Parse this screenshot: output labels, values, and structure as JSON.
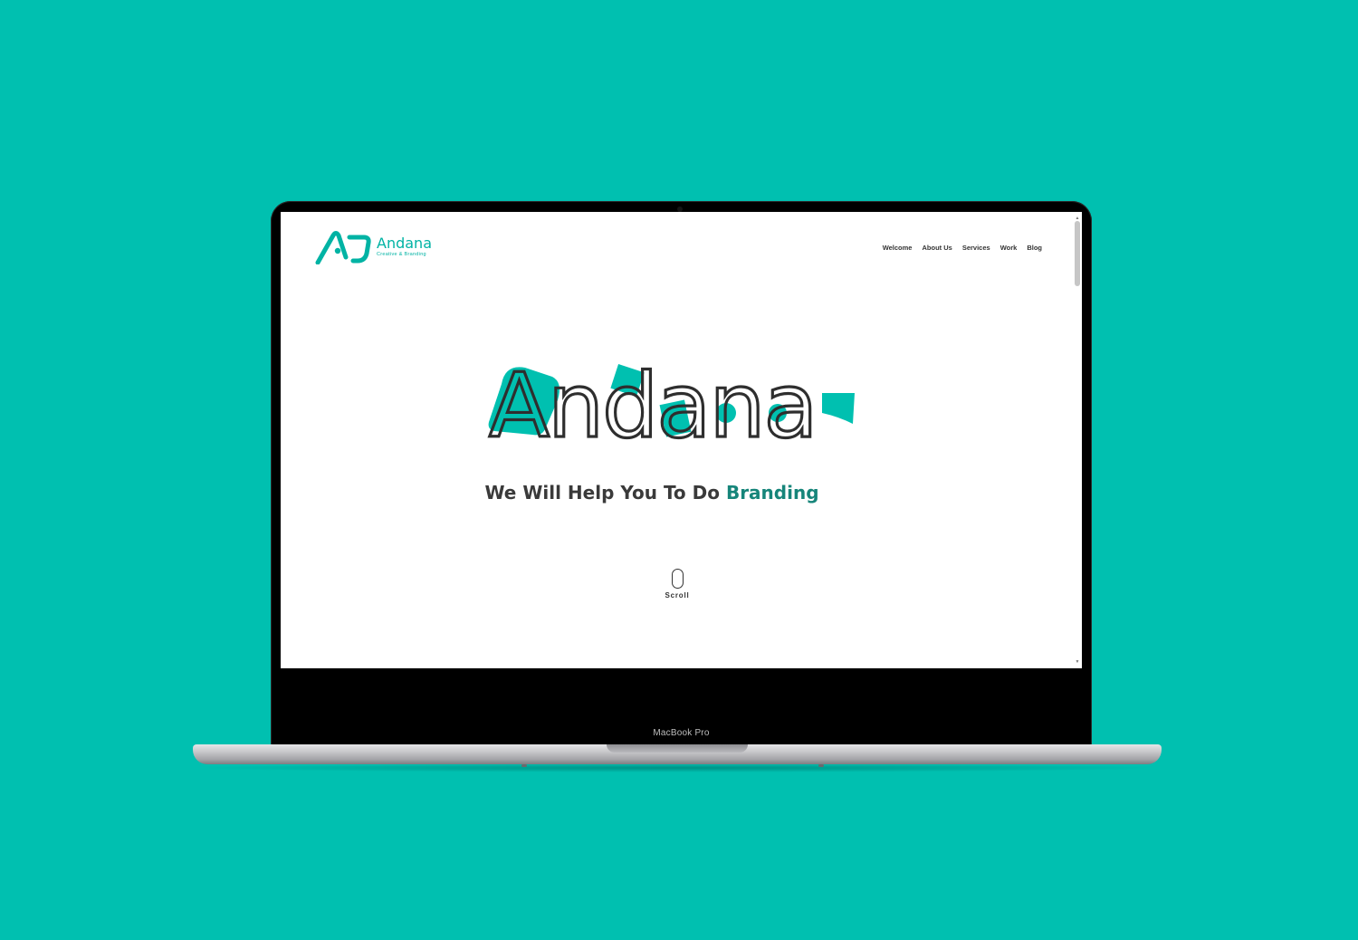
{
  "device": {
    "model_label": "MacBook Pro"
  },
  "site": {
    "brand": {
      "name": "Andana",
      "tagline": "Creative & Branding",
      "color": "#00b3a4"
    },
    "nav": [
      {
        "label": "Welcome"
      },
      {
        "label": "About Us"
      },
      {
        "label": "Services"
      },
      {
        "label": "Work"
      },
      {
        "label": "Blog"
      }
    ],
    "hero": {
      "wordmark": "Andana",
      "headline_main": "We Will Help You To Do",
      "headline_accent": "Branding",
      "accent_color": "#16857a"
    },
    "scroll": {
      "label": "Scroll",
      "icon": "mouse-icon"
    }
  },
  "colors": {
    "page_background": "#00c0b0",
    "text_dark": "#333333"
  }
}
